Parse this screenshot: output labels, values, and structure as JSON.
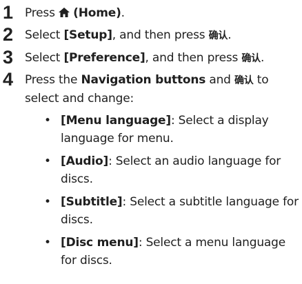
{
  "steps": [
    {
      "number": "1",
      "pre": "Press ",
      "icon": "home-icon",
      "bold": "(Home)",
      "post": "."
    },
    {
      "number": "2",
      "pre": "Select ",
      "bold": "[Setup]",
      "mid": ", and then press ",
      "button": "确认",
      "post": "."
    },
    {
      "number": "3",
      "pre": "Select ",
      "bold": "[Preference]",
      "mid": ", and then press ",
      "button": "确认",
      "post": "."
    },
    {
      "number": "4",
      "pre": "Press the ",
      "bold": "Navigation buttons",
      "mid": " and ",
      "button": "确认",
      "post": " to select and change:"
    }
  ],
  "bullets": [
    {
      "symbol": "•",
      "label": "[Menu language]",
      "text": ": Select a display language for menu."
    },
    {
      "symbol": "•",
      "label": "[Audio]",
      "text": ": Select an audio language for discs."
    },
    {
      "symbol": "•",
      "label": "[Subtitle]",
      "text": ": Select a subtitle language for discs."
    },
    {
      "symbol": "•",
      "label": "[Disc menu]",
      "text": ": Select a menu language for discs."
    }
  ]
}
